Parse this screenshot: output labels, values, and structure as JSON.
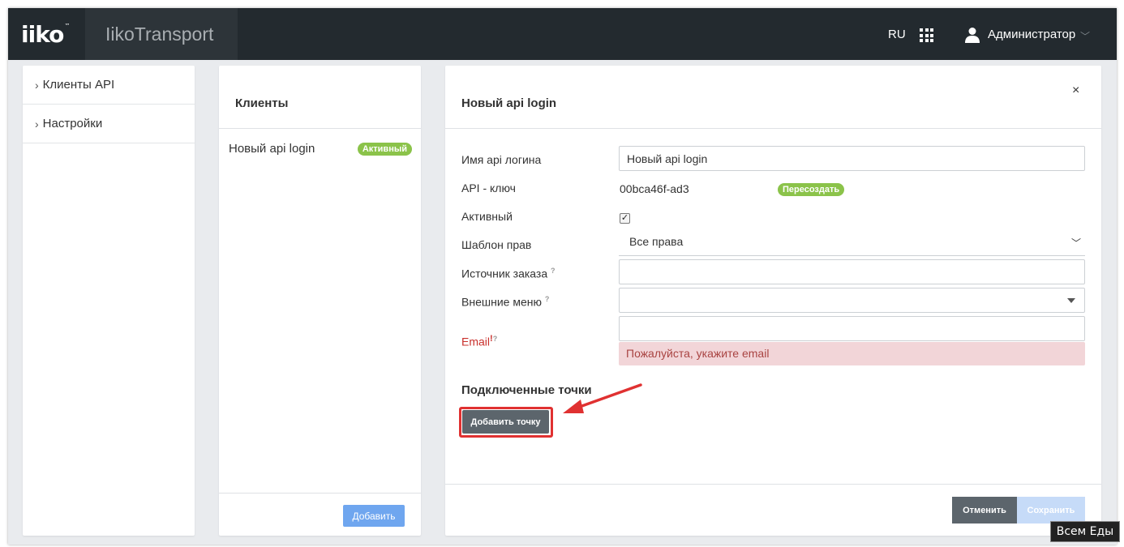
{
  "header": {
    "logo": "iiko",
    "logo_tm": "™",
    "app_name": "IikoTransport",
    "lang": "RU",
    "user": "Администратор"
  },
  "sidebar": {
    "items": [
      {
        "label": "Клиенты API"
      },
      {
        "label": "Настройки"
      }
    ]
  },
  "clients_panel": {
    "title": "Клиенты",
    "items": [
      {
        "name": "Новый api login",
        "status": "Активный"
      }
    ],
    "add_button": "Добавить"
  },
  "form": {
    "title": "Новый api login",
    "close": "×",
    "fields": {
      "login_name_label": "Имя api логина",
      "login_name_value": "Новый api login",
      "api_key_label": "API - ключ",
      "api_key_value": "00bca46f-ad3",
      "regenerate_button": "Пересоздать",
      "active_label": "Активный",
      "active_checked": true,
      "rights_label": "Шаблон прав",
      "rights_value": "Все права",
      "order_source_label": "Источник заказа",
      "order_source_value": "",
      "ext_menu_label": "Внешние меню",
      "ext_menu_value": "",
      "email_label": "Email",
      "email_value": "",
      "email_error": "Пожалуйста, укажите email",
      "help_mark": "?",
      "required_mark": "!"
    },
    "points_section_title": "Подключенные точки",
    "add_point_button": "Добавить точку",
    "cancel_button": "Отменить",
    "save_button": "Сохранить"
  },
  "tooltip": "Всем Еды",
  "colors": {
    "topbar": "#232a2f",
    "badge_green": "#8bc34a",
    "primary_blue": "#6fa6ef",
    "error_bg": "#f2d5d8",
    "error_text": "#a94442",
    "highlight_red": "#e03131",
    "dark_button": "#5c656c"
  }
}
